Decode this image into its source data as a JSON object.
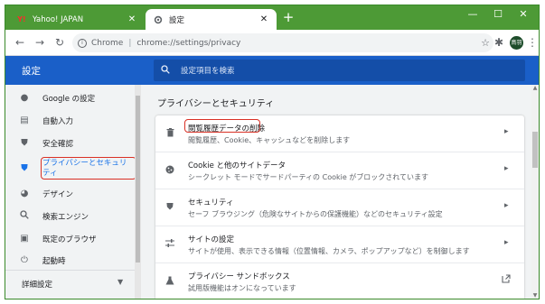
{
  "browser": {
    "tabs": [
      {
        "label": "Yahoo! JAPAN",
        "favicon": "Y!",
        "close": "✕"
      },
      {
        "label": "設定",
        "favicon": "gear-icon",
        "close": "✕"
      }
    ],
    "new_tab": "+",
    "window_controls": {
      "minimize": "—",
      "maximize": "☐",
      "close": "✕"
    },
    "omnibox": {
      "site_label": "Chrome",
      "separator": "|",
      "url": "chrome://settings/privacy"
    },
    "profile_initials": "鳥羽"
  },
  "settings": {
    "title": "設定",
    "search_placeholder": "設定項目を検索",
    "sidebar": [
      {
        "label": "Google の設定",
        "icon": "person-icon"
      },
      {
        "label": "自動入力",
        "icon": "clipboard-icon"
      },
      {
        "label": "安全確認",
        "icon": "shield-check-icon"
      },
      {
        "label": "プライバシーとセキュリティ",
        "icon": "shield-icon",
        "selected": true
      },
      {
        "label": "デザイン",
        "icon": "palette-icon"
      },
      {
        "label": "検索エンジン",
        "icon": "search-icon"
      },
      {
        "label": "既定のブラウザ",
        "icon": "browser-icon"
      },
      {
        "label": "起動時",
        "icon": "power-icon"
      }
    ],
    "advanced": "詳細設定",
    "section_title": "プライバシーとセキュリティ",
    "rows": [
      {
        "title": "閲覧履歴データの削除",
        "subtitle": "閲覧履歴、Cookie、キャッシュなどを削除します",
        "icon": "trash-icon"
      },
      {
        "title": "Cookie と他のサイトデータ",
        "subtitle": "シークレット モードでサードパーティの Cookie がブロックされています",
        "icon": "cookie-icon"
      },
      {
        "title": "セキュリティ",
        "subtitle": "セーフ ブラウジング（危険なサイトからの保護機能）などのセキュリティ設定",
        "icon": "shield-icon"
      },
      {
        "title": "サイトの設定",
        "subtitle": "サイトが使用、表示できる情報（位置情報、カメラ、ポップアップなど）を制御します",
        "icon": "sliders-icon"
      },
      {
        "title": "プライバシー サンドボックス",
        "subtitle": "試用版機能はオンになっています",
        "icon": "flask-icon"
      }
    ]
  },
  "colors": {
    "tabbar": "#4d9a36",
    "header": "#1a5fc8",
    "accent": "#1a73e8",
    "highlight_border": "#d93025"
  }
}
